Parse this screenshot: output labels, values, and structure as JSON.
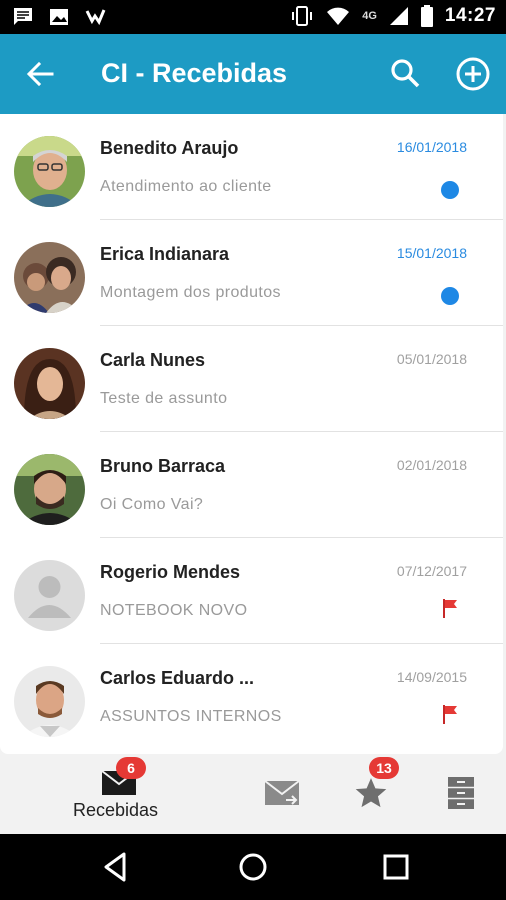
{
  "status_bar": {
    "time": "14:27",
    "network": "4G",
    "icons": [
      "message-icon",
      "image-icon",
      "check-icon",
      "vibrate-icon",
      "wifi-icon",
      "signal-icon",
      "battery-icon"
    ]
  },
  "app_bar": {
    "title": "CI - Recebidas",
    "color": "#1d9bc4",
    "icons": [
      "back-arrow-icon",
      "search-icon",
      "add-circle-icon"
    ]
  },
  "messages": [
    {
      "sender": "Benedito Araujo",
      "subject": "Atendimento ao cliente",
      "date": "16/01/2018",
      "unread": true,
      "flagged": false
    },
    {
      "sender": "Erica Indianara",
      "subject": "Montagem dos produtos",
      "date": "15/01/2018",
      "unread": true,
      "flagged": false
    },
    {
      "sender": "Carla Nunes",
      "subject": "Teste de assunto",
      "date": "05/01/2018",
      "unread": false,
      "flagged": false
    },
    {
      "sender": "Bruno Barraca",
      "subject": "Oi Como Vai?",
      "date": "02/01/2018",
      "unread": false,
      "flagged": false
    },
    {
      "sender": "Rogerio Mendes",
      "subject": "NOTEBOOK NOVO",
      "date": "07/12/2017",
      "unread": false,
      "flagged": true
    },
    {
      "sender": "Carlos Eduardo ...",
      "subject": "ASSUNTOS INTERNOS",
      "date": "14/09/2015",
      "unread": false,
      "flagged": true
    }
  ],
  "bottom_nav": {
    "received": {
      "label": "Recebidas",
      "badge": "6",
      "icon": "inbox-envelope-icon"
    },
    "sent": {
      "icon": "sent-envelope-icon"
    },
    "starred": {
      "badge": "13",
      "icon": "star-icon"
    },
    "archive": {
      "icon": "archive-cabinet-icon"
    }
  },
  "colors": {
    "accent": "#1d9bc4",
    "unread_date": "#2a8be0",
    "unread_dot": "#1e88e5",
    "badge": "#e53935",
    "flag": "#e53935"
  }
}
